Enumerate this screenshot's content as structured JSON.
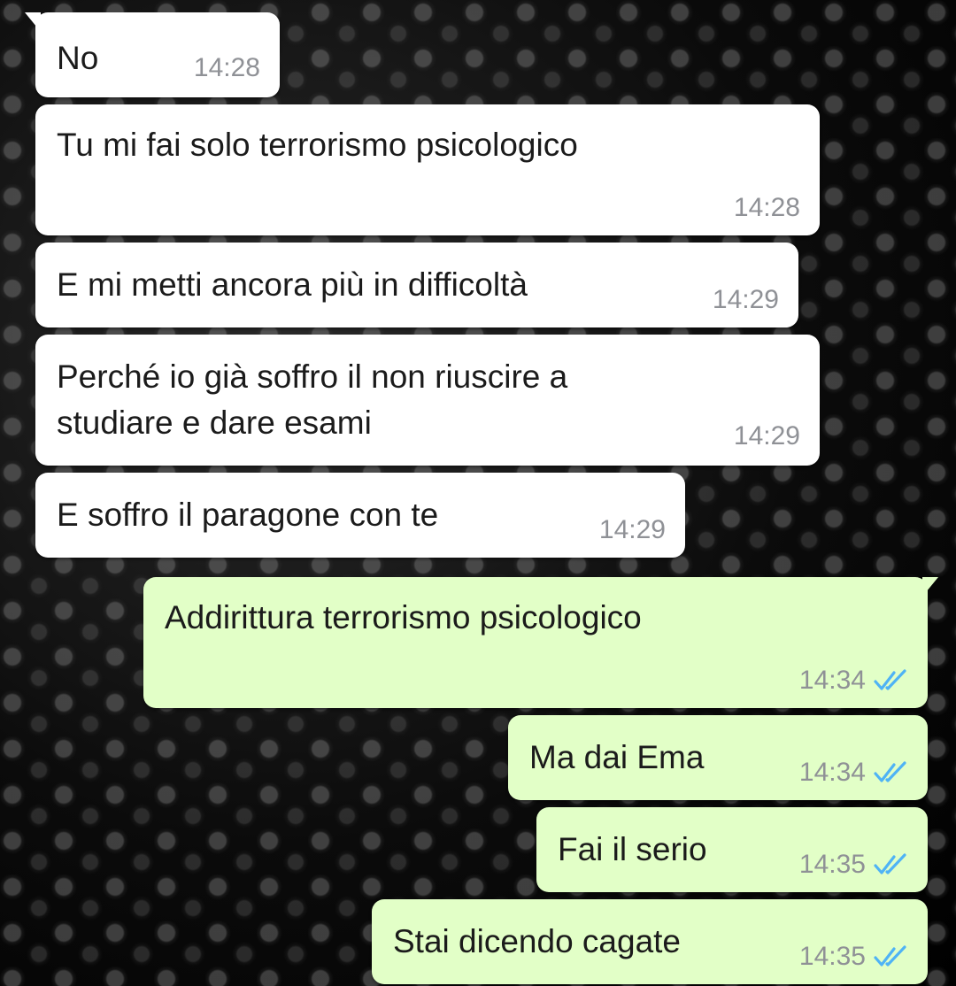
{
  "colors": {
    "incoming_bubble": "#ffffff",
    "outgoing_bubble": "#e2ffc7",
    "timestamp": "#8f9196",
    "read_ticks": "#4fb3f5"
  },
  "messages": [
    {
      "text": "No",
      "time": "14:28"
    },
    {
      "text": "Tu mi fai solo terrorismo psicologico",
      "time": "14:28"
    },
    {
      "text": "E mi metti ancora più in difficoltà",
      "time": "14:29"
    },
    {
      "text": "Perché io già soffro il non riuscire a\nstudiare e dare esami",
      "time": "14:29"
    },
    {
      "text": "E soffro il paragone con te",
      "time": "14:29"
    },
    {
      "text": "Addirittura terrorismo psicologico",
      "time": "14:34",
      "status_icon": "double-check-icon"
    },
    {
      "text": "Ma dai Ema",
      "time": "14:34",
      "status_icon": "double-check-icon"
    },
    {
      "text": "Fai il serio",
      "time": "14:35",
      "status_icon": "double-check-icon"
    },
    {
      "text": "Stai dicendo cagate",
      "time": "14:35",
      "status_icon": "double-check-icon"
    }
  ]
}
